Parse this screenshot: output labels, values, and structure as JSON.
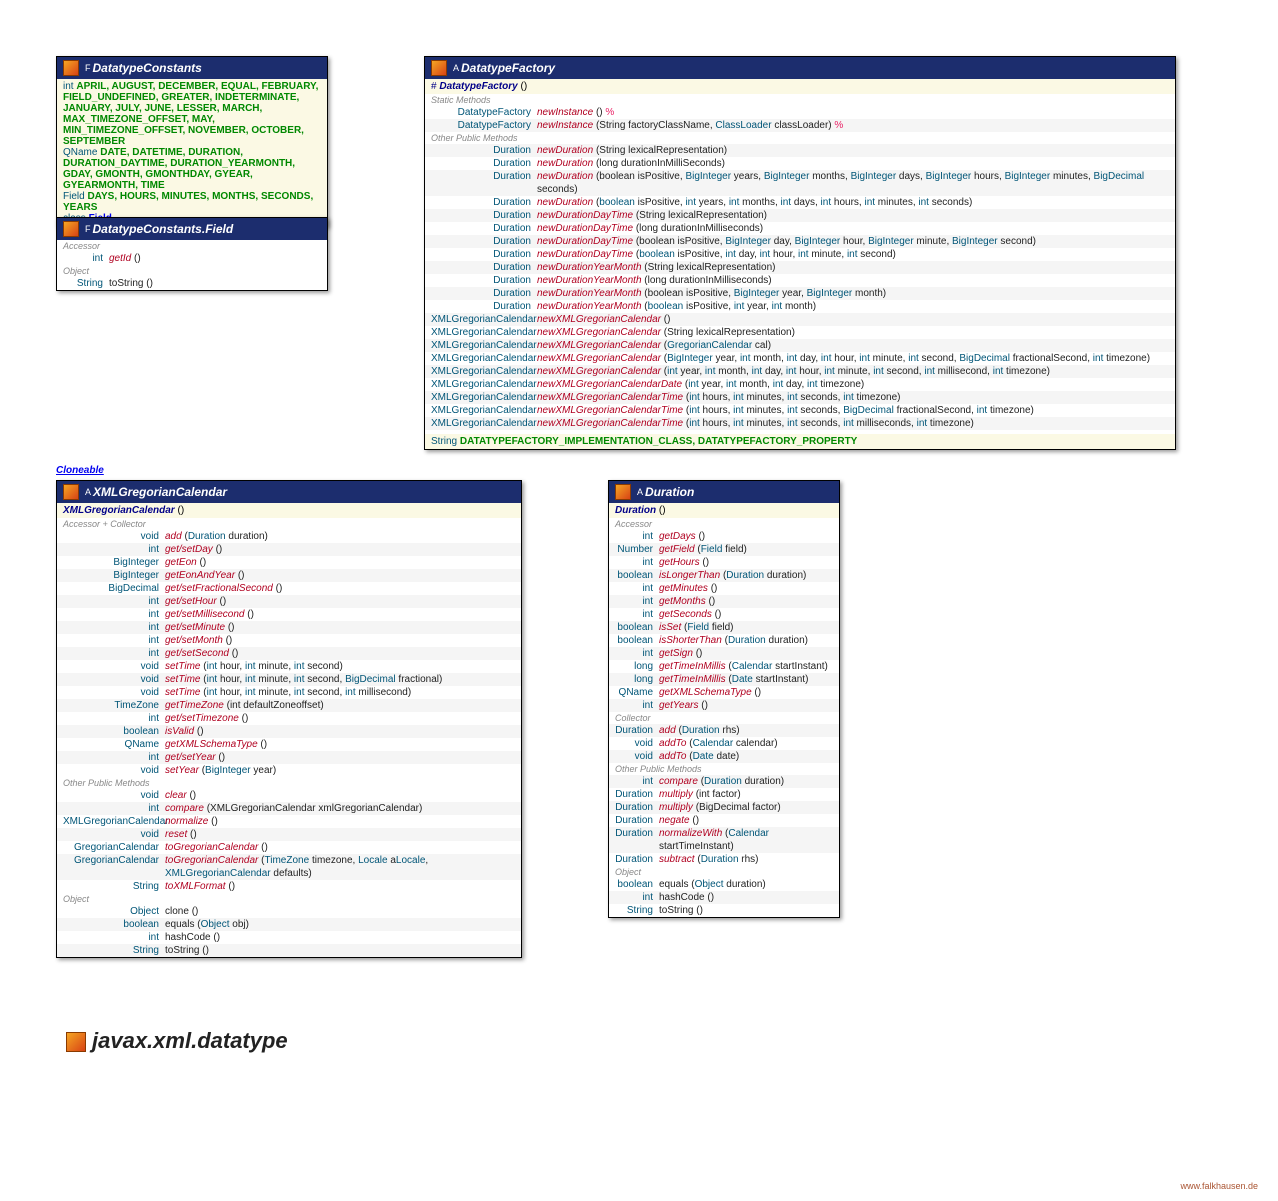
{
  "pkg": "javax.xml.datatype",
  "credit": "www.falkhausen.de",
  "cloneable": "Cloneable",
  "dc": {
    "title": "DatatypeConstants",
    "ints": "APRIL, AUGUST, DECEMBER, EQUAL, FEBRUARY, FIELD_UNDEFINED, GREATER, INDETERMINATE, JANUARY, JULY, JUNE, LESSER, MARCH, MAX_TIMEZONE_OFFSET, MAY, MIN_TIMEZONE_OFFSET, NOVEMBER, OCTOBER, SEPTEMBER",
    "qn": "DATE, DATETIME, DURATION, DURATION_DAYTIME, DURATION_YEARMONTH, GDAY, GMONTH, GMONTHDAY, GYEAR, GYEARMONTH, TIME",
    "fld": "DAYS, HOURS, MINUTES, MONTHS, SECONDS, YEARS",
    "cls": "Field"
  },
  "dcf": {
    "title": "DatatypeConstants.Field",
    "rows": [
      {
        "rt": "int",
        "m": "getId",
        "a": "()"
      },
      {
        "rt": "String",
        "m": "toString",
        "a": "()",
        "obj": true
      }
    ]
  },
  "df": {
    "title": "DatatypeFactory",
    "ctor": "DatatypeFactory",
    "consts": "DATATYPEFACTORY_IMPLEMENTATION_CLASS, DATATYPEFACTORY_PROPERTY",
    "sm": [
      {
        "rt": "DatatypeFactory",
        "m": "newInstance",
        "a": "()",
        "ex": true
      },
      {
        "rt": "DatatypeFactory",
        "m": "newInstance",
        "a": "(String factoryClassName, ",
        "a2": "ClassLoader",
        "a3": " classLoader)",
        "ex": true
      }
    ],
    "pm": [
      {
        "rt": "Duration",
        "m": "newDuration",
        "a": "(String lexicalRepresentation)"
      },
      {
        "rt": "Duration",
        "m": "newDuration",
        "a": "(long durationInMilliSeconds)"
      },
      {
        "rt": "Duration",
        "m": "newDuration",
        "a": "(boolean isPositive, BigInteger years, BigInteger months, BigInteger days, BigInteger hours, BigInteger minutes, BigDecimal seconds)",
        "bi": true
      },
      {
        "rt": "Duration",
        "m": "newDuration",
        "a": "(boolean isPositive, int years, int months, int days, int hours, int minutes, int seconds)",
        "ik": true
      },
      {
        "rt": "Duration",
        "m": "newDurationDayTime",
        "a": "(String lexicalRepresentation)"
      },
      {
        "rt": "Duration",
        "m": "newDurationDayTime",
        "a": "(long durationInMilliseconds)"
      },
      {
        "rt": "Duration",
        "m": "newDurationDayTime",
        "a": "(boolean isPositive, BigInteger day, BigInteger hour, BigInteger minute, BigInteger second)",
        "bi": true
      },
      {
        "rt": "Duration",
        "m": "newDurationDayTime",
        "a": "(boolean isPositive, int day, int hour, int minute, int second)",
        "ik": true
      },
      {
        "rt": "Duration",
        "m": "newDurationYearMonth",
        "a": "(String lexicalRepresentation)"
      },
      {
        "rt": "Duration",
        "m": "newDurationYearMonth",
        "a": "(long durationInMilliseconds)"
      },
      {
        "rt": "Duration",
        "m": "newDurationYearMonth",
        "a": "(boolean isPositive, BigInteger year, BigInteger month)",
        "bi": true
      },
      {
        "rt": "Duration",
        "m": "newDurationYearMonth",
        "a": "(boolean isPositive, int year, int month)",
        "ik": true
      },
      {
        "rt": "XMLGregorianCalendar",
        "m": "newXMLGregorianCalendar",
        "a": "()"
      },
      {
        "rt": "XMLGregorianCalendar",
        "m": "newXMLGregorianCalendar",
        "a": "(String lexicalRepresentation)"
      },
      {
        "rt": "XMLGregorianCalendar",
        "m": "newXMLGregorianCalendar",
        "a": "(GregorianCalendar cal)",
        "gc": true
      },
      {
        "rt": "XMLGregorianCalendar",
        "m": "newXMLGregorianCalendar",
        "a": "(BigInteger year, int month, int day, int hour, int minute, int second, BigDecimal fractionalSecond, int timezone)",
        "bi": true,
        "ik": true
      },
      {
        "rt": "XMLGregorianCalendar",
        "m": "newXMLGregorianCalendar",
        "a": "(int year, int month, int day, int hour, int minute, int second, int millisecond, int timezone)",
        "ik": true
      },
      {
        "rt": "XMLGregorianCalendar",
        "m": "newXMLGregorianCalendarDate",
        "a": "(int year, int month, int day, int timezone)",
        "ik": true
      },
      {
        "rt": "XMLGregorianCalendar",
        "m": "newXMLGregorianCalendarTime",
        "a": "(int hours, int minutes, int seconds, int timezone)",
        "ik": true
      },
      {
        "rt": "XMLGregorianCalendar",
        "m": "newXMLGregorianCalendarTime",
        "a": "(int hours, int minutes, int seconds, BigDecimal fractionalSecond, int timezone)",
        "bi": true,
        "ik": true
      },
      {
        "rt": "XMLGregorianCalendar",
        "m": "newXMLGregorianCalendarTime",
        "a": "(int hours, int minutes, int seconds, int milliseconds, int timezone)",
        "ik": true
      }
    ]
  },
  "xgc": {
    "title": "XMLGregorianCalendar",
    "ctor": "XMLGregorianCalendar",
    "ac": [
      {
        "rt": "void",
        "m": "add",
        "a": "(Duration duration)"
      },
      {
        "rt": "int",
        "m": "get/setDay",
        "a": "()"
      },
      {
        "rt": "BigInteger",
        "m": "getEon",
        "a": "()"
      },
      {
        "rt": "BigInteger",
        "m": "getEonAndYear",
        "a": "()"
      },
      {
        "rt": "BigDecimal",
        "m": "get/setFractionalSecond",
        "a": "()"
      },
      {
        "rt": "int",
        "m": "get/setHour",
        "a": "()"
      },
      {
        "rt": "int",
        "m": "get/setMillisecond",
        "a": "()"
      },
      {
        "rt": "int",
        "m": "get/setMinute",
        "a": "()"
      },
      {
        "rt": "int",
        "m": "get/setMonth",
        "a": "()"
      },
      {
        "rt": "int",
        "m": "get/setSecond",
        "a": "()"
      },
      {
        "rt": "void",
        "m": "setTime",
        "a": "(int hour, int minute, int second)",
        "ik": true
      },
      {
        "rt": "void",
        "m": "setTime",
        "a": "(int hour, int minute, int second, BigDecimal fractional)",
        "ik": true,
        "bi": true
      },
      {
        "rt": "void",
        "m": "setTime",
        "a": "(int hour, int minute, int second, int millisecond)",
        "ik": true
      },
      {
        "rt": "TimeZone",
        "m": "getTimeZone",
        "a": "(int defaultZoneoffset)"
      },
      {
        "rt": "int",
        "m": "get/setTimezone",
        "a": "()"
      },
      {
        "rt": "boolean",
        "m": "isValid",
        "a": "()"
      },
      {
        "rt": "QName",
        "m": "getXMLSchemaType",
        "a": "()"
      },
      {
        "rt": "int",
        "m": "get/setYear",
        "a": "()"
      },
      {
        "rt": "void",
        "m": "setYear",
        "a": "(BigInteger year)",
        "bi": true
      }
    ],
    "op": [
      {
        "rt": "void",
        "m": "clear",
        "a": "()"
      },
      {
        "rt": "int",
        "m": "compare",
        "a": "(XMLGregorianCalendar xmlGregorianCalendar)"
      },
      {
        "rt": "XMLGregorianCalendar",
        "m": "normalize",
        "a": "()"
      },
      {
        "rt": "void",
        "m": "reset",
        "a": "()"
      },
      {
        "rt": "GregorianCalendar",
        "m": "toGregorianCalendar",
        "a": "()"
      },
      {
        "rt": "GregorianCalendar",
        "m": "toGregorianCalendar",
        "a": "(TimeZone timezone, Locale aLocale, XMLGregorianCalendar defaults)",
        "tl": true
      },
      {
        "rt": "String",
        "m": "toXMLFormat",
        "a": "()"
      }
    ],
    "ob": [
      {
        "rt": "Object",
        "m": "clone",
        "a": "()"
      },
      {
        "rt": "boolean",
        "m": "equals",
        "a": "(Object obj)"
      },
      {
        "rt": "int",
        "m": "hashCode",
        "a": "()"
      },
      {
        "rt": "String",
        "m": "toString",
        "a": "()"
      }
    ]
  },
  "dur": {
    "title": "Duration",
    "ctor": "Duration",
    "ac": [
      {
        "rt": "int",
        "m": "getDays",
        "a": "()"
      },
      {
        "rt": "Number",
        "m": "getField",
        "a": "(Field field)"
      },
      {
        "rt": "int",
        "m": "getHours",
        "a": "()"
      },
      {
        "rt": "boolean",
        "m": "isLongerThan",
        "a": "(Duration duration)"
      },
      {
        "rt": "int",
        "m": "getMinutes",
        "a": "()"
      },
      {
        "rt": "int",
        "m": "getMonths",
        "a": "()"
      },
      {
        "rt": "int",
        "m": "getSeconds",
        "a": "()"
      },
      {
        "rt": "boolean",
        "m": "isSet",
        "a": "(Field field)"
      },
      {
        "rt": "boolean",
        "m": "isShorterThan",
        "a": "(Duration duration)"
      },
      {
        "rt": "int",
        "m": "getSign",
        "a": "()"
      },
      {
        "rt": "long",
        "m": "getTimeInMillis",
        "a": "(Calendar startInstant)"
      },
      {
        "rt": "long",
        "m": "getTimeInMillis",
        "a": "(Date startInstant)"
      },
      {
        "rt": "QName",
        "m": "getXMLSchemaType",
        "a": "()"
      },
      {
        "rt": "int",
        "m": "getYears",
        "a": "()"
      }
    ],
    "co": [
      {
        "rt": "Duration",
        "m": "add",
        "a": "(Duration rhs)"
      },
      {
        "rt": "void",
        "m": "addTo",
        "a": "(Calendar calendar)"
      },
      {
        "rt": "void",
        "m": "addTo",
        "a": "(Date date)"
      }
    ],
    "op": [
      {
        "rt": "int",
        "m": "compare",
        "a": "(Duration duration)"
      },
      {
        "rt": "Duration",
        "m": "multiply",
        "a": "(int factor)"
      },
      {
        "rt": "Duration",
        "m": "multiply",
        "a": "(BigDecimal factor)"
      },
      {
        "rt": "Duration",
        "m": "negate",
        "a": "()"
      },
      {
        "rt": "Duration",
        "m": "normalizeWith",
        "a": "(Calendar startTimeInstant)"
      },
      {
        "rt": "Duration",
        "m": "subtract",
        "a": "(Duration rhs)"
      }
    ],
    "ob": [
      {
        "rt": "boolean",
        "m": "equals",
        "a": "(Object duration)"
      },
      {
        "rt": "int",
        "m": "hashCode",
        "a": "()"
      },
      {
        "rt": "String",
        "m": "toString",
        "a": "()"
      }
    ]
  }
}
